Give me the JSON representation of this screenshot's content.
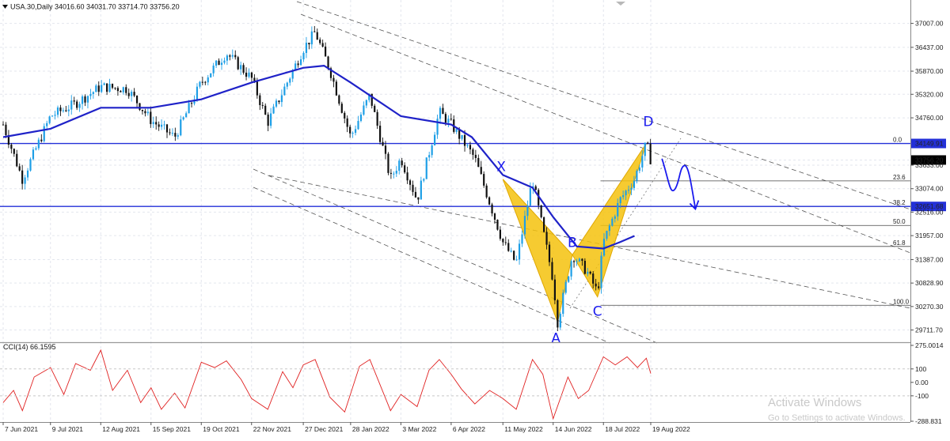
{
  "window": {
    "symbol_line": "USA.30,Daily  34016.60 34031.70 33714.70 33756.20",
    "indicator_line": "CCI(14) 66.1595"
  },
  "colors": {
    "up_candle": "#1e9fe6",
    "down_candle": "#111111",
    "ma_line": "#1f22c8",
    "h_line": "#2330d8",
    "pattern_fill": "#f4c20d",
    "cci_line": "#e02020",
    "hand_annot": "#1a1aee",
    "grid": "#e3e6ee",
    "price_tag_bg": "#2330d8",
    "current_tag_bg": "#000000"
  },
  "icons": {
    "dropdown": "triangle-down-icon"
  },
  "chart_data": [
    {
      "type": "candlestick",
      "title": "USA.30,Daily",
      "ohlc_header": {
        "open": 34016.6,
        "high": 34031.7,
        "low": 33714.7,
        "close": 33756.2
      },
      "price_axis_labels": [
        "37007.00",
        "36437.00",
        "35870.00",
        "35320.00",
        "34760.00",
        "34149.91",
        "33756.20",
        "33633.00",
        "33074.00",
        "32651.68",
        "32516.00",
        "31957.00",
        "31387.00",
        "30828.90",
        "30270.30",
        "29711.70"
      ],
      "time_axis_labels": [
        "7 Jun 2021",
        "9 Jul 2021",
        "12 Aug 2021",
        "15 Sep 2021",
        "19 Oct 2021",
        "22 Nov 2021",
        "27 Dec 2021",
        "28 Jan 2022",
        "3 Mar 2022",
        "6 Apr 2022",
        "11 May 2022",
        "14 Jun 2022",
        "18 Jul 2022",
        "19 Aug 2022"
      ],
      "ylim": [
        29440,
        37300
      ],
      "close_path": [
        [
          "7 Jun 2021",
          34600
        ],
        [
          "20 Jun 2021",
          33300
        ],
        [
          "9 Jul 2021",
          34800
        ],
        [
          "26 Jul 2021",
          35100
        ],
        [
          "12 Aug 2021",
          35500
        ],
        [
          "30 Aug 2021",
          35450
        ],
        [
          "15 Sep 2021",
          34700
        ],
        [
          "1 Oct 2021",
          34300
        ],
        [
          "19 Oct 2021",
          35600
        ],
        [
          "5 Nov 2021",
          36300
        ],
        [
          "22 Nov 2021",
          35700
        ],
        [
          "3 Dec 2021",
          34650
        ],
        [
          "27 Dec 2021",
          36400
        ],
        [
          "4 Jan 2022",
          36800
        ],
        [
          "14 Jan 2022",
          35900
        ],
        [
          "28 Jan 2022",
          34300
        ],
        [
          "10 Feb 2022",
          35300
        ],
        [
          "24 Feb 2022",
          33300
        ],
        [
          "3 Mar 2022",
          33800
        ],
        [
          "14 Mar 2022",
          32800
        ],
        [
          "29 Mar 2022",
          34900
        ],
        [
          "6 Apr 2022",
          34600
        ],
        [
          "22 Apr 2022",
          33800
        ],
        [
          "11 May 2022",
          31800
        ],
        [
          "20 May 2022",
          31300
        ],
        [
          "31 May 2022",
          33300
        ],
        [
          "14 Jun 2022",
          30900
        ],
        [
          "17 Jun 2022",
          29900
        ],
        [
          "27 Jun 2022",
          31500
        ],
        [
          "7 Jul 2022",
          31100
        ],
        [
          "14 Jul 2022",
          30600
        ],
        [
          "18 Jul 2022",
          31800
        ],
        [
          "29 Jul 2022",
          32800
        ],
        [
          "8 Aug 2022",
          33300
        ],
        [
          "16 Aug 2022",
          34150
        ],
        [
          "19 Aug 2022",
          33756
        ]
      ],
      "moving_average_path": [
        [
          "7 Jun 2021",
          34300
        ],
        [
          "9 Jul 2021",
          34500
        ],
        [
          "12 Aug 2021",
          35000
        ],
        [
          "15 Sep 2021",
          35000
        ],
        [
          "19 Oct 2021",
          35200
        ],
        [
          "22 Nov 2021",
          35600
        ],
        [
          "27 Dec 2021",
          35950
        ],
        [
          "10 Jan 2022",
          36000
        ],
        [
          "28 Jan 2022",
          35600
        ],
        [
          "3 Mar 2022",
          34800
        ],
        [
          "6 Apr 2022",
          34600
        ],
        [
          "20 Apr 2022",
          34300
        ],
        [
          "11 May 2022",
          33400
        ],
        [
          "31 May 2022",
          33100
        ],
        [
          "14 Jun 2022",
          32400
        ],
        [
          "30 Jun 2022",
          31700
        ],
        [
          "18 Jul 2022",
          31650
        ],
        [
          "29 Jul 2022",
          31800
        ],
        [
          "8 Aug 2022",
          31950
        ]
      ],
      "horizontal_levels": [
        34149.91,
        32651.68
      ],
      "harmonic_points": [
        {
          "label": "X",
          "date": "11 May 2022",
          "price": 33300
        },
        {
          "label": "A",
          "date": "17 Jun 2022",
          "price": 29900
        },
        {
          "label": "B",
          "date": "27 Jun 2022",
          "price": 31500
        },
        {
          "label": "C",
          "date": "14 Jul 2022",
          "price": 30500
        },
        {
          "label": "D",
          "date": "16 Aug 2022",
          "price": 34150
        }
      ],
      "fibonacci_levels": [
        {
          "label": "0.0",
          "price": 34149.91
        },
        {
          "label": "23.6",
          "price": 33260
        },
        {
          "label": "38.2",
          "price": 32651.68
        },
        {
          "label": "50.0",
          "price": 32200
        },
        {
          "label": "61.8",
          "price": 31700
        },
        {
          "label": "100.0",
          "price": 30300
        }
      ],
      "annotation_letters": [
        "X",
        "A",
        "B",
        "C",
        "D"
      ],
      "grid": true
    },
    {
      "type": "line",
      "title": "CCI(14) 66.1595",
      "axis_labels": [
        "275.0014",
        "100",
        "0.00",
        "-100",
        "-288.831"
      ],
      "ylim": [
        -288.831,
        275.0014
      ],
      "series": [
        {
          "name": "CCI(14)",
          "points": [
            [
              "7 Jun 2021",
              -150
            ],
            [
              "14 Jun 2021",
              -60
            ],
            [
              "20 Jun 2021",
              -210
            ],
            [
              "28 Jun 2021",
              40
            ],
            [
              "9 Jul 2021",
              110
            ],
            [
              "18 Jul 2021",
              -90
            ],
            [
              "26 Jul 2021",
              140
            ],
            [
              "5 Aug 2021",
              90
            ],
            [
              "12 Aug 2021",
              240
            ],
            [
              "20 Aug 2021",
              -60
            ],
            [
              "30 Aug 2021",
              90
            ],
            [
              "8 Sep 2021",
              -150
            ],
            [
              "15 Sep 2021",
              -40
            ],
            [
              "22 Sep 2021",
              -200
            ],
            [
              "1 Oct 2021",
              -80
            ],
            [
              "8 Oct 2021",
              -190
            ],
            [
              "19 Oct 2021",
              150
            ],
            [
              "28 Oct 2021",
              110
            ],
            [
              "5 Nov 2021",
              160
            ],
            [
              "15 Nov 2021",
              20
            ],
            [
              "22 Nov 2021",
              -120
            ],
            [
              "3 Dec 2021",
              -200
            ],
            [
              "13 Dec 2021",
              80
            ],
            [
              "20 Dec 2021",
              -40
            ],
            [
              "27 Dec 2021",
              130
            ],
            [
              "4 Jan 2022",
              170
            ],
            [
              "14 Jan 2022",
              -110
            ],
            [
              "24 Jan 2022",
              -220
            ],
            [
              "3 Feb 2022",
              120
            ],
            [
              "10 Feb 2022",
              170
            ],
            [
              "24 Feb 2022",
              -210
            ],
            [
              "3 Mar 2022",
              -90
            ],
            [
              "14 Mar 2022",
              -180
            ],
            [
              "22 Mar 2022",
              90
            ],
            [
              "29 Mar 2022",
              170
            ],
            [
              "6 Apr 2022",
              60
            ],
            [
              "13 Apr 2022",
              -50
            ],
            [
              "22 Apr 2022",
              -160
            ],
            [
              "2 May 2022",
              -60
            ],
            [
              "11 May 2022",
              -120
            ],
            [
              "20 May 2022",
              -200
            ],
            [
              "31 May 2022",
              170
            ],
            [
              "7 Jun 2022",
              60
            ],
            [
              "14 Jun 2022",
              -270
            ],
            [
              "24 Jun 2022",
              40
            ],
            [
              "1 Jul 2022",
              -120
            ],
            [
              "8 Jul 2022",
              -60
            ],
            [
              "18 Jul 2022",
              190
            ],
            [
              "26 Jul 2022",
              130
            ],
            [
              "3 Aug 2022",
              190
            ],
            [
              "10 Aug 2022",
              110
            ],
            [
              "16 Aug 2022",
              180
            ],
            [
              "19 Aug 2022",
              66.16
            ]
          ]
        }
      ]
    }
  ],
  "watermark": {
    "line1": "Activate Windows",
    "line2": "Go to Settings to activate Windows."
  }
}
